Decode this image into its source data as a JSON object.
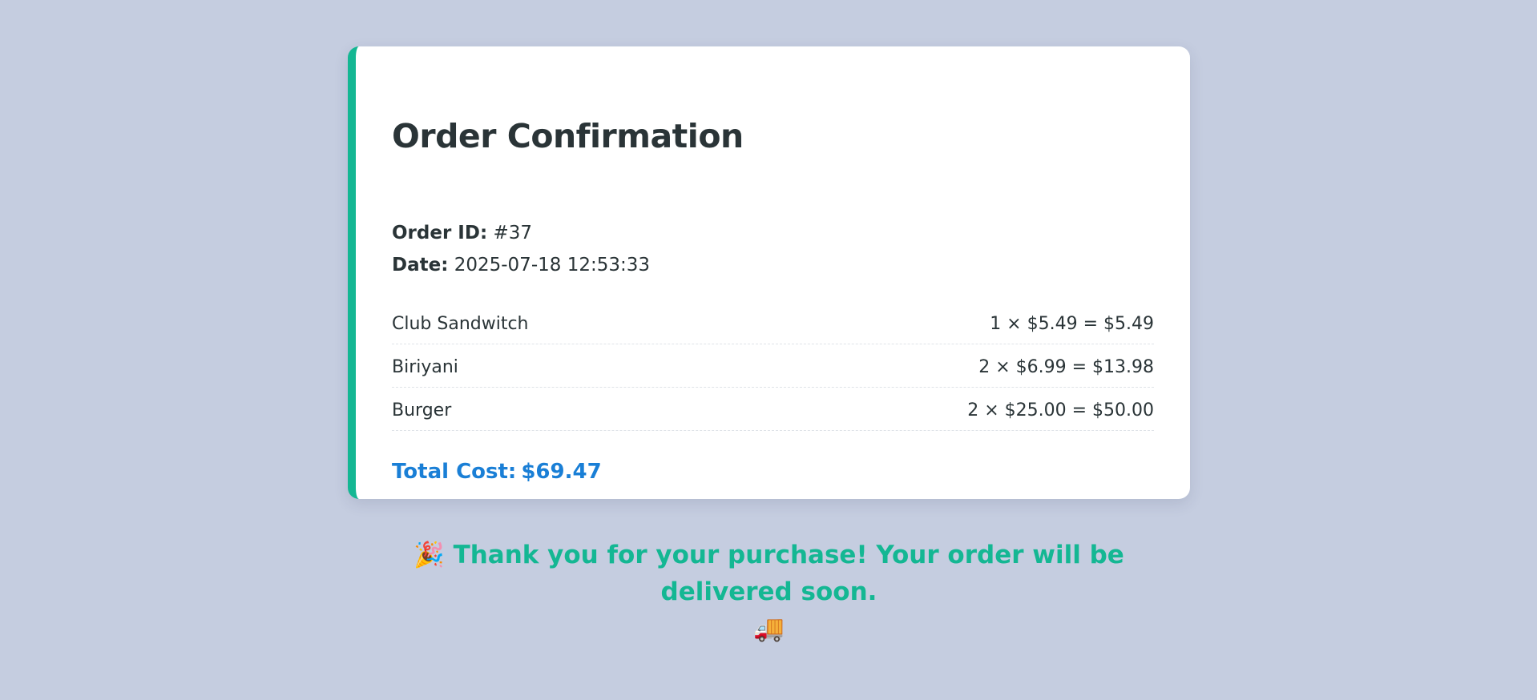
{
  "order": {
    "title": "Order Confirmation",
    "id_label": "Order ID:",
    "id_value": "#37",
    "date_label": "Date:",
    "date_value": "2025-07-18 12:53:33",
    "items": [
      {
        "name": "Club Sandwitch",
        "calc": "1 × $5.49 = $5.49"
      },
      {
        "name": "Biriyani",
        "calc": "2 × $6.99 = $13.98"
      },
      {
        "name": "Burger",
        "calc": "2 × $25.00 = $50.00"
      }
    ],
    "total_label": "Total Cost:",
    "total_value": "$69.47"
  },
  "message": {
    "leading_emoji": "🎉",
    "text": "Thank you for your purchase! Your order will be delivered soon.",
    "trailing_emoji": "🚚"
  },
  "colors": {
    "background": "#c5cde0",
    "card_accent": "#14b793",
    "total_text": "#1a7fd6",
    "message_text": "#14b793",
    "body_text": "#2a3437"
  },
  "icons": {
    "leading": "party-popper-icon",
    "trailing": "delivery-truck-icon"
  }
}
